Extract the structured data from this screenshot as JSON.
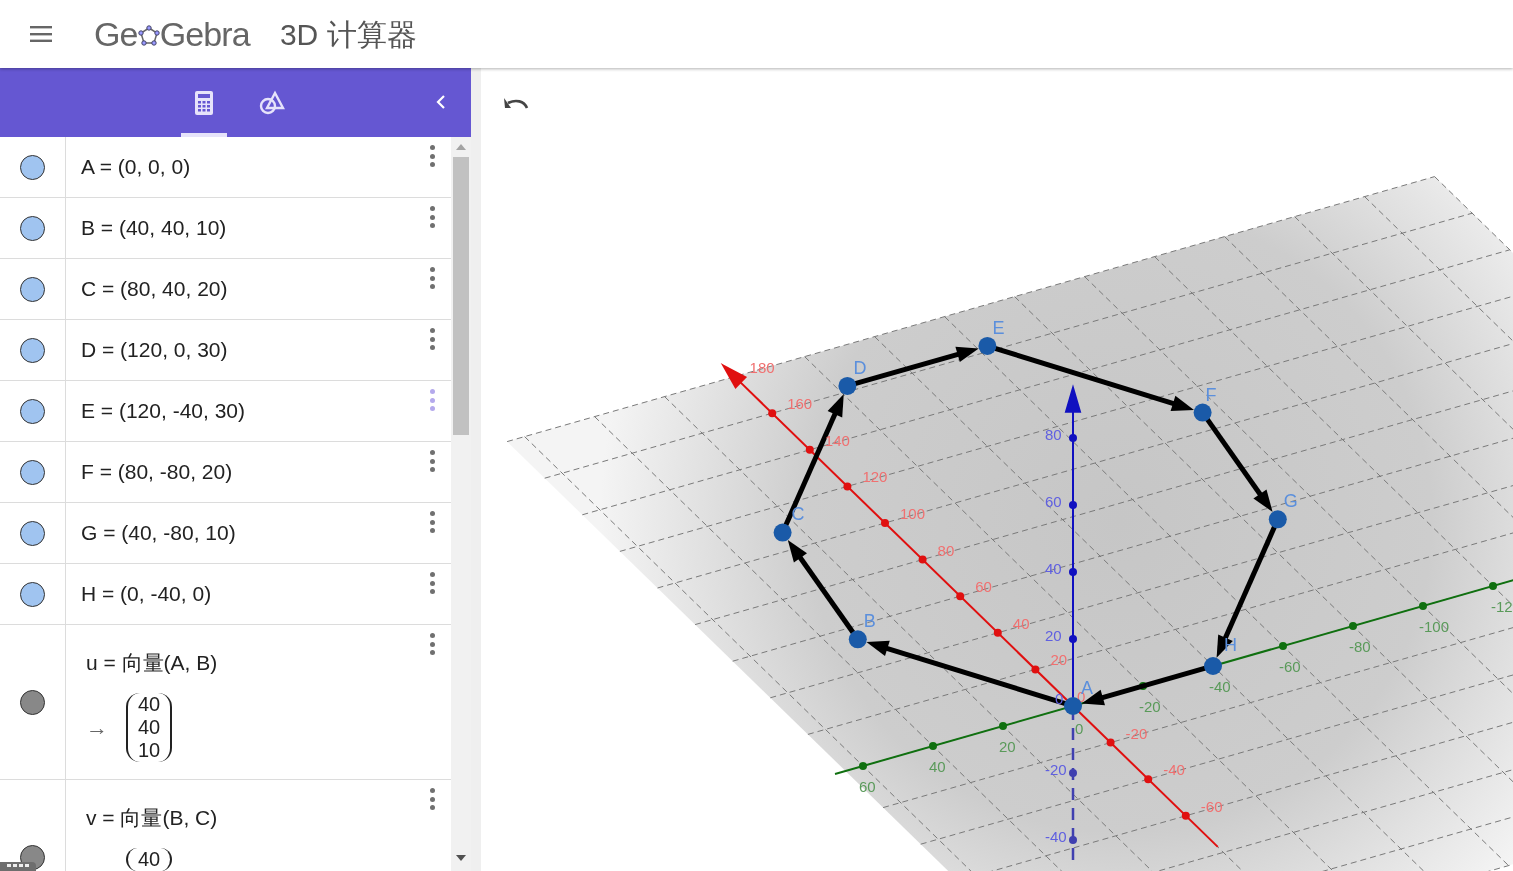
{
  "header": {
    "logo_left": "Ge",
    "logo_right": "Gebra",
    "title": "3D 计算器"
  },
  "toolbar": {
    "tabs": [
      {
        "kind": "algebra",
        "selected": true
      },
      {
        "kind": "tools",
        "selected": false
      }
    ]
  },
  "algebra": {
    "items": [
      {
        "kind": "point",
        "text": "A = (0, 0, 0)",
        "color": "#a0c4f0",
        "menu_highlighted": false
      },
      {
        "kind": "point",
        "text": "B = (40, 40, 10)",
        "color": "#a0c4f0",
        "menu_highlighted": false
      },
      {
        "kind": "point",
        "text": "C = (80, 40, 20)",
        "color": "#a0c4f0",
        "menu_highlighted": false
      },
      {
        "kind": "point",
        "text": "D = (120, 0, 30)",
        "color": "#a0c4f0",
        "menu_highlighted": false
      },
      {
        "kind": "point",
        "text": "E = (120, -40, 30)",
        "color": "#a0c4f0",
        "menu_highlighted": true
      },
      {
        "kind": "point",
        "text": "F = (80, -80, 20)",
        "color": "#a0c4f0",
        "menu_highlighted": false
      },
      {
        "kind": "point",
        "text": "G = (40, -80, 10)",
        "color": "#a0c4f0",
        "menu_highlighted": false
      },
      {
        "kind": "point",
        "text": "H = (0, -40, 0)",
        "color": "#a0c4f0",
        "menu_highlighted": false
      },
      {
        "kind": "vector",
        "text": "u = 向量(A, B)",
        "arrow": "→",
        "output": [
          "40",
          "40",
          "10"
        ],
        "color": "#888888",
        "menu_highlighted": false
      },
      {
        "kind": "vector",
        "text": "v = 向量(B, C)",
        "output": [
          "40"
        ],
        "color": "#888888",
        "menu_highlighted": false
      }
    ]
  },
  "graphics": {
    "points": [
      {
        "label": "A"
      },
      {
        "label": "B"
      },
      {
        "label": "C"
      },
      {
        "label": "D"
      },
      {
        "label": "E"
      },
      {
        "label": "F"
      },
      {
        "label": "G"
      },
      {
        "label": "H"
      }
    ],
    "axes": [
      {
        "kind": "x",
        "labels": [
          "180",
          "160",
          "140",
          "120",
          "100",
          "80",
          "60",
          "40",
          "20",
          "0",
          "-20",
          "-40",
          "-60"
        ]
      },
      {
        "kind": "y",
        "labels": [
          "60",
          "40",
          "20",
          "0",
          "-20",
          "-40",
          "-60",
          "-80",
          "-100",
          "-12"
        ]
      },
      {
        "kind": "z",
        "labels": [
          "80",
          "60",
          "40",
          "20",
          "0",
          "-20",
          "-40"
        ]
      }
    ]
  }
}
